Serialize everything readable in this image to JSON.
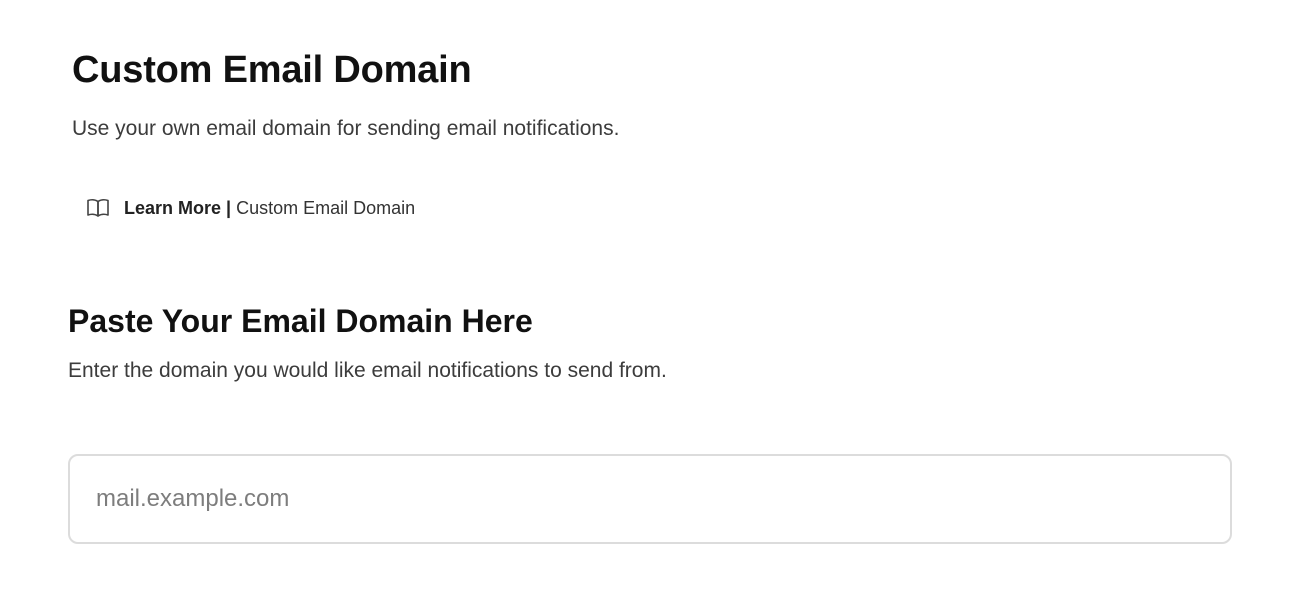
{
  "header": {
    "title": "Custom Email Domain",
    "description": "Use your own email domain for sending email notifications."
  },
  "learn_more": {
    "icon": "book-icon",
    "label": "Learn More",
    "separator": "|",
    "topic": "Custom Email Domain"
  },
  "section": {
    "title": "Paste Your Email Domain Here",
    "description": "Enter the domain you would like email notifications to send from."
  },
  "domain_input": {
    "value": "",
    "placeholder": "mail.example.com"
  }
}
